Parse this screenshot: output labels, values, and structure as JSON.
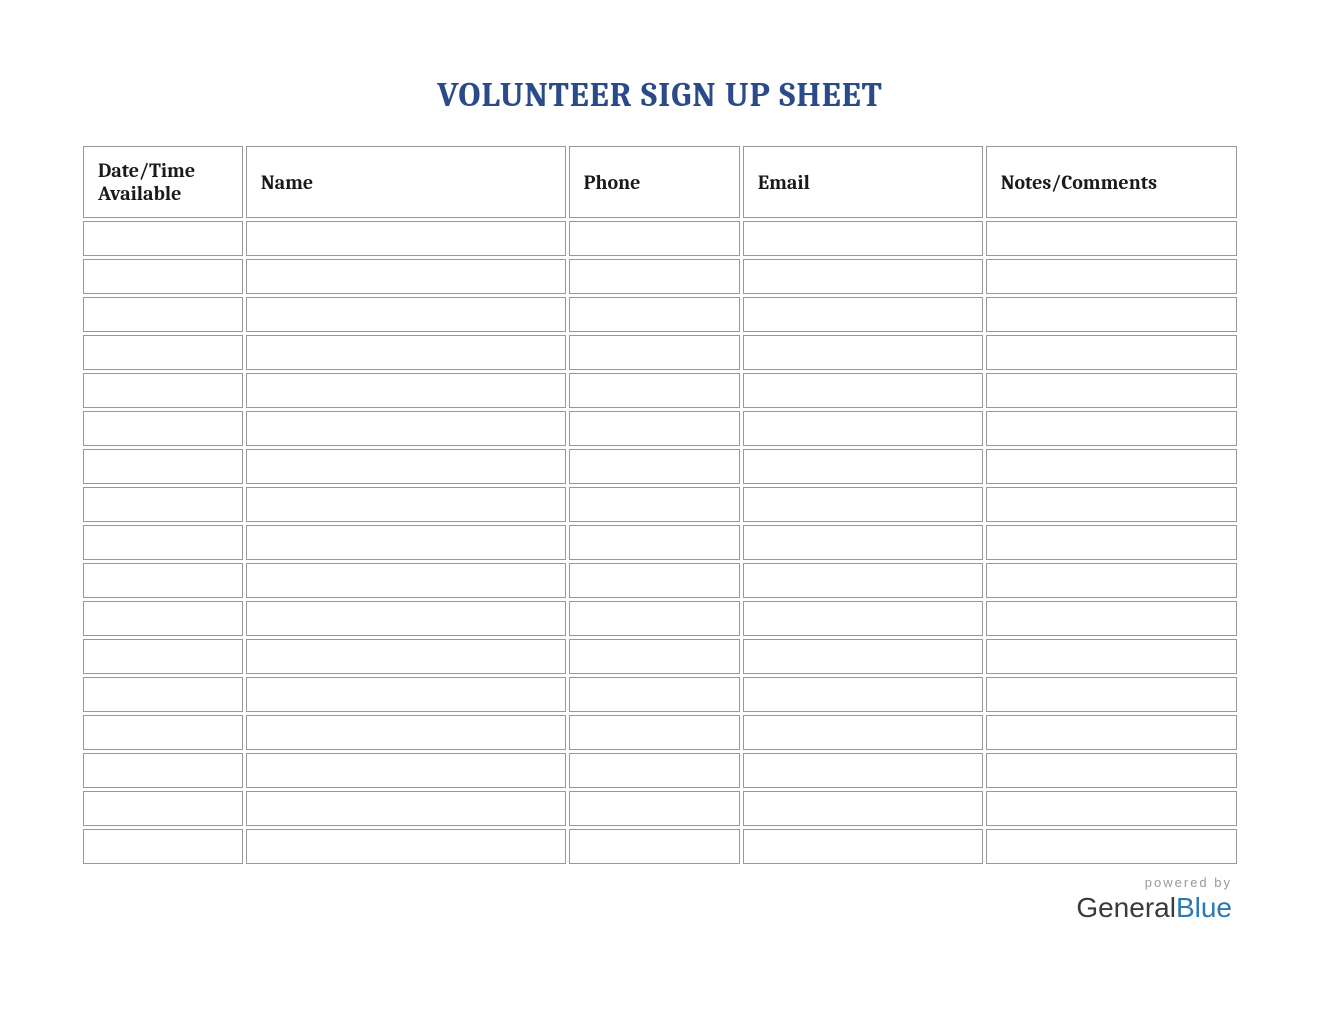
{
  "title": "VOLUNTEER SIGN UP SHEET",
  "table": {
    "headers": {
      "datetime": "Date/Time Available",
      "name": "Name",
      "phone": "Phone",
      "email": "Email",
      "notes": "Notes/Comments"
    },
    "rows": [
      {
        "datetime": "",
        "name": "",
        "phone": "",
        "email": "",
        "notes": ""
      },
      {
        "datetime": "",
        "name": "",
        "phone": "",
        "email": "",
        "notes": ""
      },
      {
        "datetime": "",
        "name": "",
        "phone": "",
        "email": "",
        "notes": ""
      },
      {
        "datetime": "",
        "name": "",
        "phone": "",
        "email": "",
        "notes": ""
      },
      {
        "datetime": "",
        "name": "",
        "phone": "",
        "email": "",
        "notes": ""
      },
      {
        "datetime": "",
        "name": "",
        "phone": "",
        "email": "",
        "notes": ""
      },
      {
        "datetime": "",
        "name": "",
        "phone": "",
        "email": "",
        "notes": ""
      },
      {
        "datetime": "",
        "name": "",
        "phone": "",
        "email": "",
        "notes": ""
      },
      {
        "datetime": "",
        "name": "",
        "phone": "",
        "email": "",
        "notes": ""
      },
      {
        "datetime": "",
        "name": "",
        "phone": "",
        "email": "",
        "notes": ""
      },
      {
        "datetime": "",
        "name": "",
        "phone": "",
        "email": "",
        "notes": ""
      },
      {
        "datetime": "",
        "name": "",
        "phone": "",
        "email": "",
        "notes": ""
      },
      {
        "datetime": "",
        "name": "",
        "phone": "",
        "email": "",
        "notes": ""
      },
      {
        "datetime": "",
        "name": "",
        "phone": "",
        "email": "",
        "notes": ""
      },
      {
        "datetime": "",
        "name": "",
        "phone": "",
        "email": "",
        "notes": ""
      },
      {
        "datetime": "",
        "name": "",
        "phone": "",
        "email": "",
        "notes": ""
      },
      {
        "datetime": "",
        "name": "",
        "phone": "",
        "email": "",
        "notes": ""
      }
    ]
  },
  "footer": {
    "powered_by": "powered by",
    "brand_general": "General",
    "brand_blue": "Blue"
  }
}
